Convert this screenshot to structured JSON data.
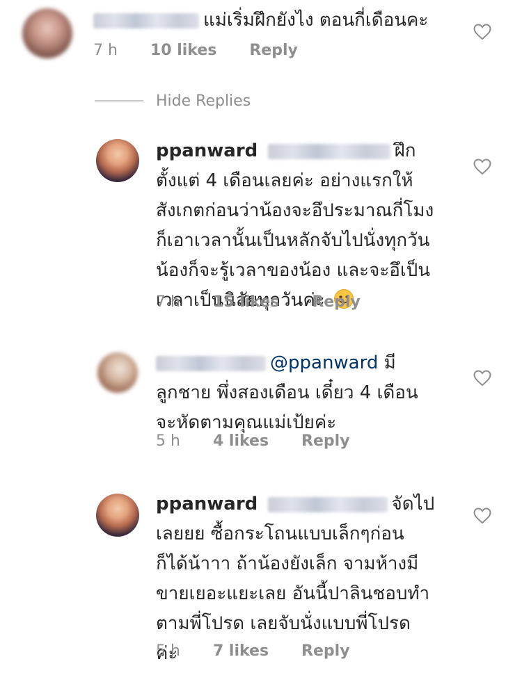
{
  "comments": [
    {
      "id": "c1",
      "text": "แม่เริ่มฝึกยังไง ตอนกี่เดือนคะ",
      "time": "7 h",
      "likes": "10 likes",
      "reply": "Reply"
    },
    {
      "id": "c2",
      "username": "ppanward",
      "text_lines": [
        "ฝึก",
        "ตั้งแต่ 4 เดือนเลยค่ะ อย่างแรกให้",
        "สังเกตก่อนว่าน้องจะอึประมาณกี่โมง",
        "ก็เอาเวลานั้นเป็นหลักจับไปนั่งทุกวัน",
        "น้องก็จะรู้เวลาของน้อง และจะอึเป็น",
        "เวลาเป็นนิสัยทุกวันค่ะ"
      ],
      "time": "7 h",
      "likes": "15 likes",
      "reply": "Reply"
    },
    {
      "id": "c3",
      "mention": "@ppanward",
      "text_lines": [
        "มี",
        "ลูกชาย พึ่งสองเดือน เดี๋ยว 4 เดือน",
        "จะหัดตามคุณแม่เป้ยค่ะ"
      ],
      "time": "5 h",
      "likes": "4 likes",
      "reply": "Reply"
    },
    {
      "id": "c4",
      "username": "ppanward",
      "text_lines": [
        "จัดไป",
        "เลยยย ซื้อกระโถนแบบเล็กๆก่อน",
        "ก็ได้น้าาา ถ้าน้องยังเล็ก จามห้างมี",
        "ขายเยอะแยะเลย อันนี้ปาลินชอบทำ",
        "ตามพี่โปรด เลยจับนั่งแบบพี่โปรด",
        "ค่ะ"
      ],
      "time": "5 h",
      "likes": "7 likes",
      "reply": "Reply"
    }
  ],
  "hide_replies_label": "Hide Replies",
  "colors": {
    "text": "#262626",
    "meta": "#8e8e8e",
    "mention": "#003569",
    "divider": "#c7c7c7"
  },
  "icons": {
    "like": "heart-outline-icon",
    "emoji": "smiling-face-emoji"
  }
}
